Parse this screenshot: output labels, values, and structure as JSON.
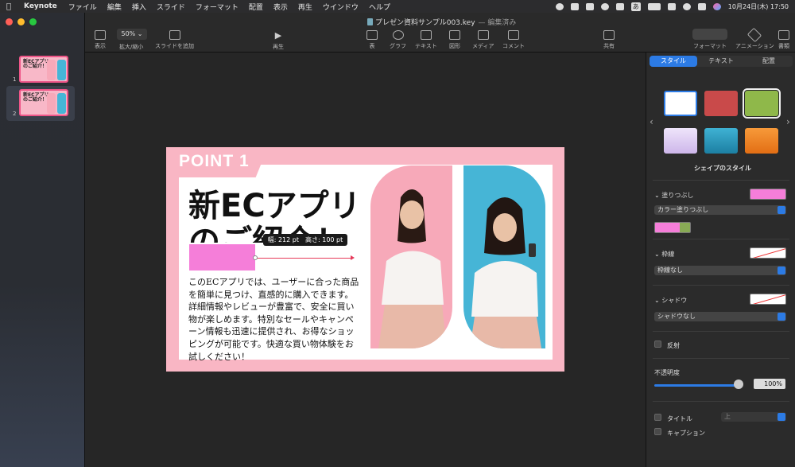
{
  "menubar": {
    "app": "Keynote",
    "items": [
      "ファイル",
      "編集",
      "挿入",
      "スライド",
      "フォーマット",
      "配置",
      "表示",
      "再生",
      "ウインドウ",
      "ヘルプ"
    ],
    "clock": "10月24日(木)  17:50",
    "ime": "あ"
  },
  "window": {
    "title": "プレゼン資料サンプル003.key",
    "subtitle": "— 編集済み"
  },
  "toolbar": {
    "view": "表示",
    "zoom_value": "50%",
    "zoom_label": "拡大/縮小",
    "add_slide": "スライドを追加",
    "play": "再生",
    "table": "表",
    "chart": "グラフ",
    "text": "テキスト",
    "shape": "図形",
    "media": "メディア",
    "comment": "コメント",
    "share": "共有",
    "format": "フォーマット",
    "animate": "アニメーション",
    "document": "書類"
  },
  "navigator": {
    "slides": [
      {
        "number": "1",
        "title": "新ECアプリ\nのご紹介！"
      },
      {
        "number": "2",
        "title": "新ECアプリ\nのご紹介！"
      }
    ]
  },
  "slide": {
    "tag": "POINT 1",
    "headline_line1": "新ECアプリ",
    "headline_line2": "のご紹介！",
    "body": "このECアプリでは、ユーザーに合った商品を簡単に見つけ、直感的に購入できます。詳細情報やレビューが豊富で、安全に買い物が楽しめます。特別なセールやキャンペーン情報も迅速に提供され、お得なショッピングが可能です。快適な買い物体験をお試しください！",
    "size_tooltip": "幅: 212 pt　高さ: 100 pt"
  },
  "inspector": {
    "tabs": [
      "スタイル",
      "テキスト",
      "配置"
    ],
    "active_tab": "スタイル",
    "shape_styles_label": "シェイプのスタイル",
    "swatches": [
      "#ffffff",
      "#c94a4a",
      "#8fb84a",
      "#d8c6f0",
      "#2a9cc0",
      "#f08a2a"
    ],
    "fill_label": "塗りつぶし",
    "fill_type": "カラー塗りつぶし",
    "fill_color": "#f57ed9",
    "border_label": "枠線",
    "border_value": "枠線なし",
    "shadow_label": "シャドウ",
    "shadow_value": "シャドウなし",
    "reflection_label": "反射",
    "opacity_label": "不透明度",
    "opacity_value": "100%",
    "title_label": "タイトル",
    "title_position": "上",
    "caption_label": "キャプション"
  }
}
